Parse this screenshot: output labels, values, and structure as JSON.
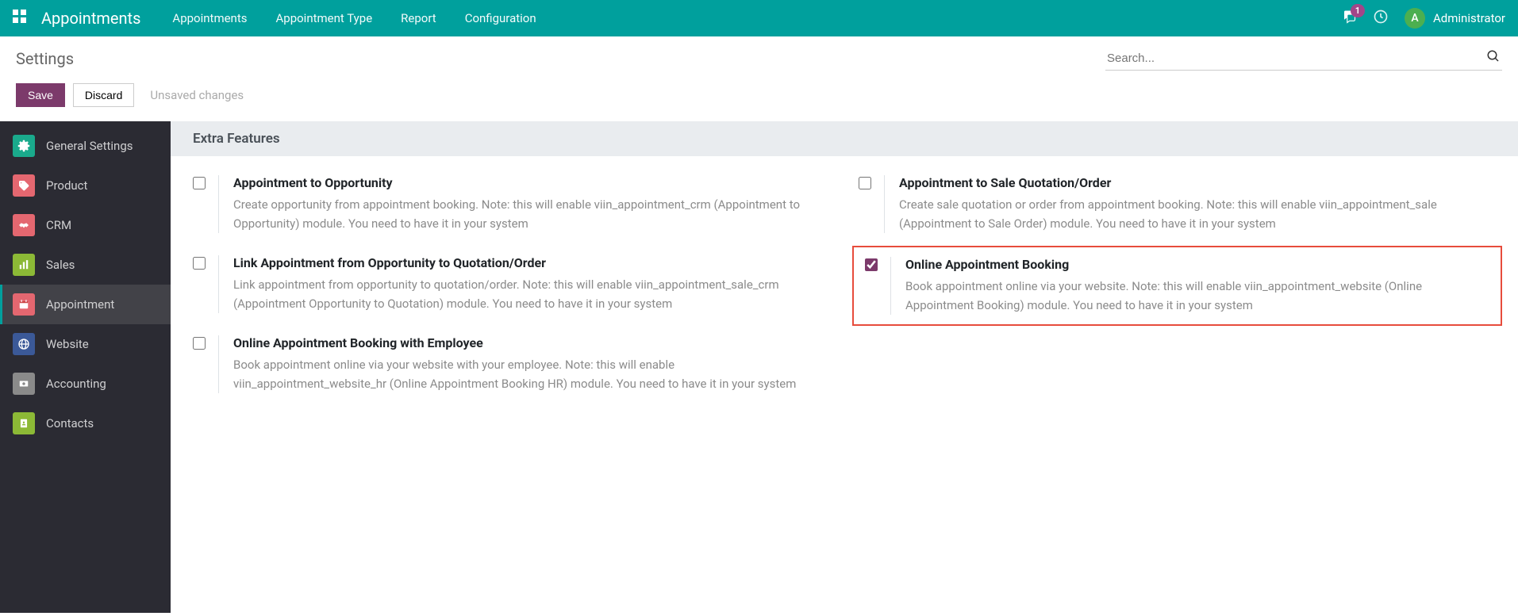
{
  "navbar": {
    "app_title": "Appointments",
    "menu": [
      "Appointments",
      "Appointment Type",
      "Report",
      "Configuration"
    ],
    "chat_badge": "1",
    "user_initial": "A",
    "user_name": "Administrator"
  },
  "control_panel": {
    "title": "Settings",
    "search_placeholder": "Search..."
  },
  "buttons": {
    "save": "Save",
    "discard": "Discard",
    "status": "Unsaved changes"
  },
  "sidebar": {
    "items": [
      {
        "icon": "general",
        "label": "General Settings"
      },
      {
        "icon": "product",
        "label": "Product"
      },
      {
        "icon": "crm",
        "label": "CRM"
      },
      {
        "icon": "sales",
        "label": "Sales"
      },
      {
        "icon": "appointment",
        "label": "Appointment",
        "active": true
      },
      {
        "icon": "website",
        "label": "Website"
      },
      {
        "icon": "accounting",
        "label": "Accounting"
      },
      {
        "icon": "contacts",
        "label": "Contacts"
      }
    ]
  },
  "section_title": "Extra Features",
  "settings": {
    "left": [
      {
        "title": "Appointment to Opportunity",
        "desc": "Create opportunity from appointment booking.\nNote: this will enable viin_appointment_crm (Appointment to Opportunity) module. You need to have it in your system",
        "checked": false
      },
      {
        "title": "Link Appointment from Opportunity to Quotation/Order",
        "desc": "Link appointment from opportunity to quotation/order.\nNote: this will enable viin_appointment_sale_crm (Appointment Opportunity to Quotation) module. You need to have it in your system",
        "checked": false
      },
      {
        "title": "Online Appointment Booking with Employee",
        "desc": "Book appointment online via your website with your employee.\nNote: this will enable viin_appointment_website_hr (Online Appointment Booking HR) module. You need to have it in your system",
        "checked": false
      }
    ],
    "right": [
      {
        "title": "Appointment to Sale Quotation/Order",
        "desc": "Create sale quotation or order from appointment booking.\nNote: this will enable viin_appointment_sale (Appointment to Sale Order) module. You need to have it in your system",
        "checked": false
      },
      {
        "title": "Online Appointment Booking",
        "desc": "Book appointment online via your website.\nNote: this will enable viin_appointment_website (Online Appointment Booking) module. You need to have it in your system",
        "checked": true,
        "highlight": true
      }
    ]
  }
}
